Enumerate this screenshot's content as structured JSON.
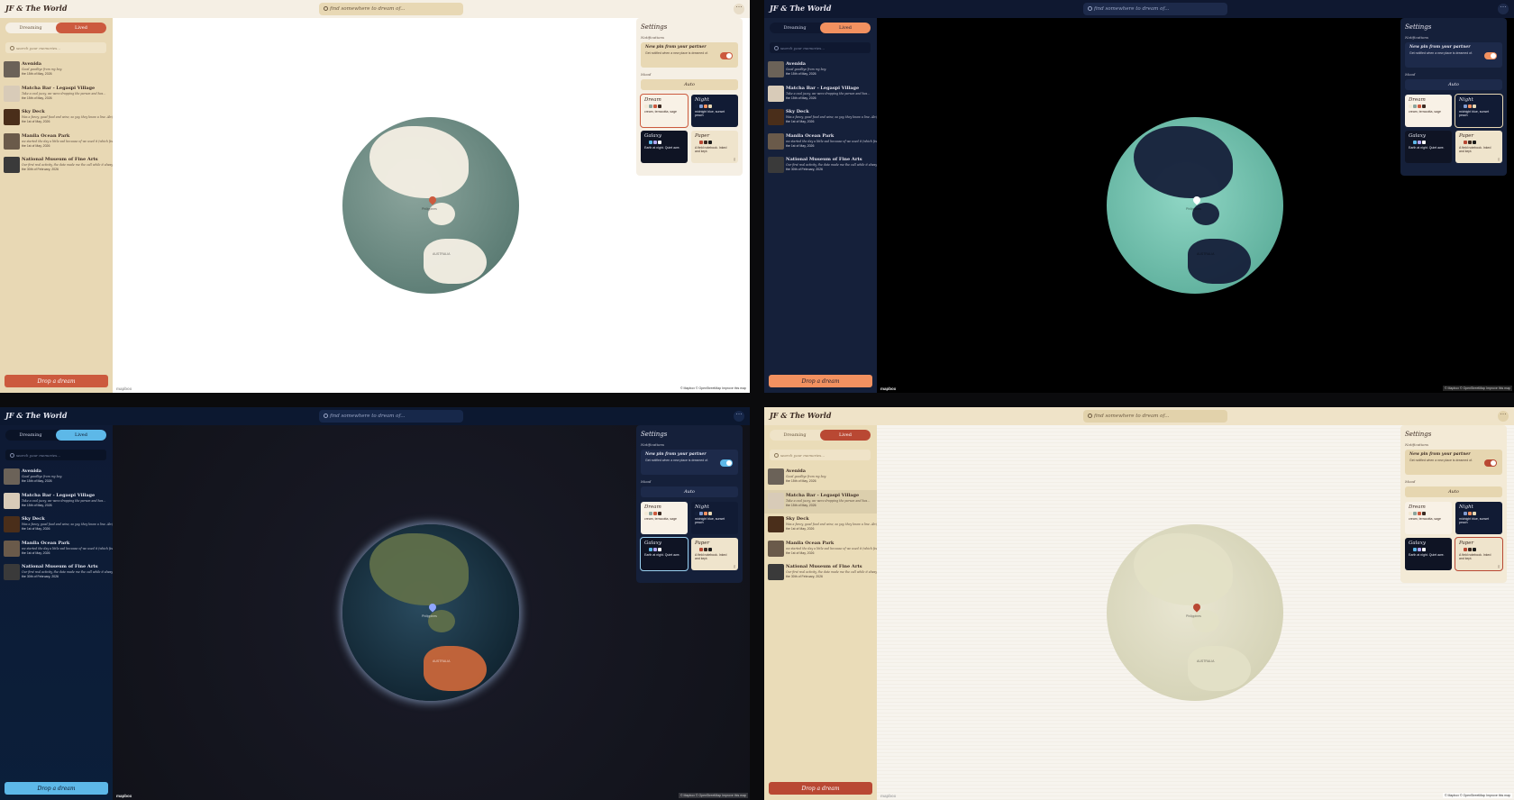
{
  "app_title": "JF & The World",
  "search": {
    "placeholder": "find somewhere to dream of..."
  },
  "toggle": {
    "dreaming": "Dreaming",
    "lived": "Lived"
  },
  "memory_search": {
    "placeholder": "search your memories..."
  },
  "memories": [
    {
      "title": "Avenida",
      "desc": "Good goodbye from my boy.",
      "date": "the 15th of May, 2026"
    },
    {
      "title": "Matcha Bar - Legaspi Village",
      "desc": "Take a cool jazzy, we were dropping the person and hea...",
      "date": "the 15th of May, 2026"
    },
    {
      "title": "Sky Deck",
      "desc": "Was a fancy, good food and wine, so yay, they know a line. Alright to",
      "date": "the 1st of May, 2026"
    },
    {
      "title": "Manila Ocean Park",
      "desc": "we started the day a little sad because of we used it (which feel). But",
      "date": "the 1st of May, 2026"
    },
    {
      "title": "National Museum of Fine Arts",
      "desc": "Our first real activity, the date made me the call while it always i...",
      "date": "the 30th of February, 2026"
    }
  ],
  "drop_button": "Drop a dream",
  "settings": {
    "title": "Settings",
    "notifications_label": "Notifications",
    "notif_title": "New pin from your partner",
    "notif_desc": "Get notified when a new place is dreamed of.",
    "mood_label": "Mood",
    "auto_label": "Auto",
    "themes": [
      {
        "name": "Dream",
        "desc": "cream, terracotta, sage",
        "swatches": [
          "#f3ead6",
          "#8ca59d",
          "#cc5a3e",
          "#3b2a22"
        ]
      },
      {
        "name": "Night",
        "desc": "midnight blue, sunset peach",
        "swatches": [
          "#15203a",
          "#7f9ad0",
          "#f29160",
          "#e8d8b4"
        ]
      },
      {
        "name": "Galaxy",
        "desc": "Earth at night. Quiet awe.",
        "swatches": [
          "#0f1424",
          "#5db8e8",
          "#b0a6f0",
          "#ffffff"
        ]
      },
      {
        "name": "Paper",
        "desc": "A field notebook. Inked and kept.",
        "swatches": [
          "#efe4cc",
          "#b94833",
          "#3b2a22",
          "#1a1a1a"
        ]
      }
    ]
  },
  "map": {
    "label_philippines": "Philippines",
    "label_australia": "AUSTRALIA",
    "mapbox": "mapbox",
    "attribution": "© Mapbox © OpenStreetMap  Improve this map"
  },
  "colors": {
    "dream_accent": "#cc5a3e",
    "night_accent": "#f29160",
    "galaxy_accent": "#5db8e8",
    "paper_accent": "#b94833"
  }
}
